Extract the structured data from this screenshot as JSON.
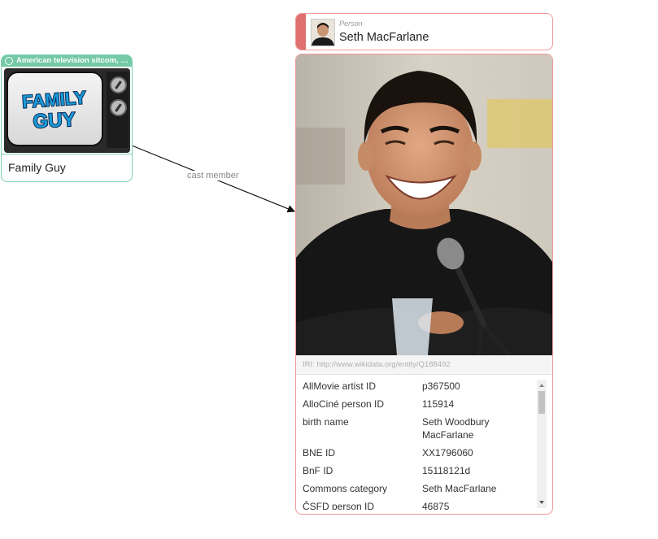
{
  "left_node": {
    "type_label": "American television sitcom, a…",
    "title": "Family Guy",
    "logo_text_1": "FAMILY",
    "logo_text_2": "GUY"
  },
  "edge": {
    "label": "cast member"
  },
  "right_node": {
    "type_label": "Person",
    "name": "Seth MacFarlane",
    "iri": "IRI: http://www.wikidata.org/entity/Q188492",
    "properties": [
      {
        "key": "AllMovie artist ID",
        "value": "p367500"
      },
      {
        "key": "AlloCiné person ID",
        "value": "115914"
      },
      {
        "key": "birth name",
        "value": "Seth Woodbury MacFarlane"
      },
      {
        "key": "BNE ID",
        "value": "XX1796060"
      },
      {
        "key": "BnF ID",
        "value": "15118121d"
      },
      {
        "key": "Commons category",
        "value": "Seth MacFarlane"
      },
      {
        "key": "ČSFD person ID",
        "value": "46875"
      }
    ]
  },
  "colors": {
    "left_accent": "#74c9a6",
    "right_accent": "#e06f6f",
    "right_border": "#ef9a9a"
  },
  "icons": {
    "type_bar": "circle-icon",
    "scroll_up": "triangle-up-icon",
    "scroll_down": "triangle-down-icon"
  }
}
